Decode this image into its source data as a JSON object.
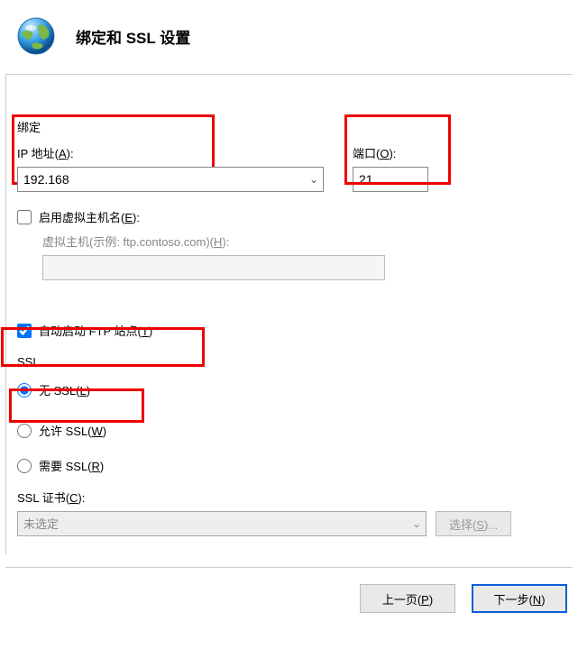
{
  "header": {
    "title": "绑定和 SSL 设置"
  },
  "binding": {
    "section_label": "绑定",
    "ip_label_prefix": "IP 地址(",
    "ip_label_key": "A",
    "ip_label_suffix": "):",
    "ip_value": "192.168",
    "port_label_prefix": "端口(",
    "port_label_key": "O",
    "port_label_suffix": "):",
    "port_value": "21",
    "vhost_checkbox_prefix": "启用虚拟主机名(",
    "vhost_checkbox_key": "E",
    "vhost_checkbox_suffix": "):",
    "vhost_hint_prefix": "虚拟主机(示例: ftp.contoso.com)(",
    "vhost_hint_key": "H",
    "vhost_hint_suffix": "):",
    "autostart_prefix": "自动启动 FTP 站点(",
    "autostart_key": "T",
    "autostart_suffix": ")"
  },
  "ssl": {
    "section_label": "SSL",
    "no_ssl_prefix": "无 SSL(",
    "no_ssl_key": "L",
    "no_ssl_suffix": ")",
    "allow_ssl_prefix": "允许 SSL(",
    "allow_ssl_key": "W",
    "allow_ssl_suffix": ")",
    "require_ssl_prefix": "需要 SSL(",
    "require_ssl_key": "R",
    "require_ssl_suffix": ")",
    "cert_label_prefix": "SSL 证书(",
    "cert_label_key": "C",
    "cert_label_suffix": "):",
    "cert_value": "未选定",
    "select_btn_prefix": "选择(",
    "select_btn_key": "S",
    "select_btn_suffix": ")..."
  },
  "footer": {
    "prev": "上一页(",
    "prev_key": "P",
    "prev_suf": ")",
    "next": "下一步(",
    "next_key": "N",
    "next_suf": ")"
  }
}
